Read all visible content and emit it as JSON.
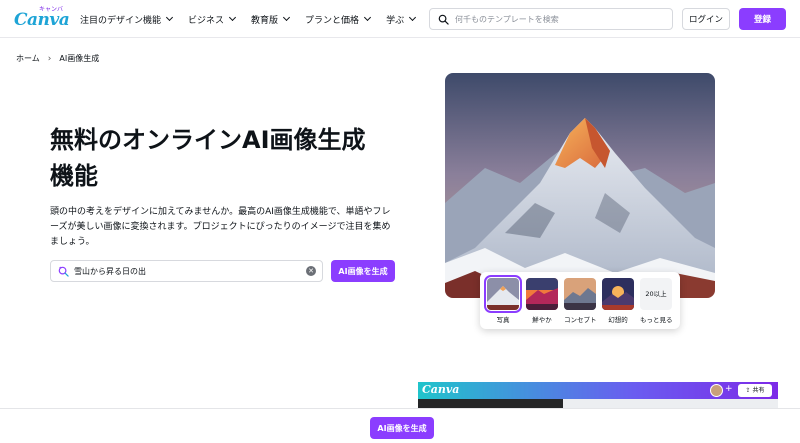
{
  "header": {
    "logo": {
      "wordmark": "Canva",
      "kana": "キャンバ"
    },
    "nav": [
      {
        "label": "注目のデザイン機能"
      },
      {
        "label": "ビジネス"
      },
      {
        "label": "教育版"
      },
      {
        "label": "プランと価格"
      },
      {
        "label": "学ぶ"
      }
    ],
    "search_placeholder": "何千ものテンプレートを検索",
    "login_label": "ログイン",
    "signup_label": "登録"
  },
  "breadcrumb": [
    "ホーム",
    "AI画像生成"
  ],
  "hero": {
    "title_line1": "無料のオンラインAI画像生成",
    "title_line2": "機能",
    "description": "頭の中の考えをデザインに加えてみませんか。最高のAI画像生成機能で、単語やフレーズが美しい画像に変換されます。プロジェクトにぴったりのイメージで注目を集めましょう。",
    "prompt_value": "雪山から昇る日の出",
    "generate_label": "AI画像を生成"
  },
  "styles": {
    "options": [
      {
        "label": "写真",
        "selected": true
      },
      {
        "label": "鮮やか",
        "selected": false
      },
      {
        "label": "コンセプト",
        "selected": false
      },
      {
        "label": "幻想的",
        "selected": false
      }
    ],
    "more_box": "20以上",
    "more_label": "もっと見る"
  },
  "editor": {
    "logo": "Canva",
    "share_label": "共有"
  },
  "sticky": {
    "generate_label": "AI画像を生成"
  },
  "colors": {
    "accent": "#8b3dff",
    "logo": "#1ea4d6"
  },
  "icons": [
    "search-icon",
    "magic-search-icon",
    "clear-icon",
    "chevron-down-icon",
    "share-icon"
  ]
}
